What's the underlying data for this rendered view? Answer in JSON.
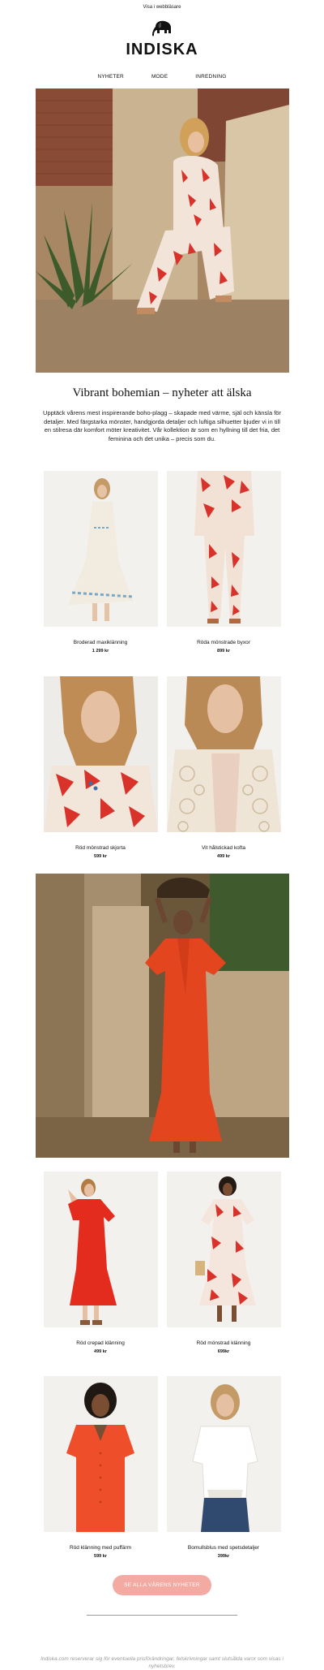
{
  "header": {
    "view_in_browser": "Visa i webbläsare",
    "brand": "INDISKA",
    "logo_icon": "elephant-icon",
    "nav": [
      "NYHETER",
      "MODE",
      "INREDNING"
    ]
  },
  "intro": {
    "headline": "Vibrant bohemian – nyheter att älska",
    "body": "Upptäck vårens mest inspirerande boho-plagg – skapade med värme, själ och känsla för detaljer. Med färgstarka mönster, handgjorda detaljer och luftiga silhuetter bjuder vi in till en stilresa där komfort möter kreativitet. Vår kollektion är som en hyllning till det fria, det feminina och det unika – precis som du."
  },
  "products": [
    {
      "name": "Broderad maxiklänning",
      "price": "1 299 kr"
    },
    {
      "name": "Röda mönstrade byxor",
      "price": "899 kr"
    },
    {
      "name": "Röd mönstrad skjorta",
      "price": "599 kr"
    },
    {
      "name": "Vit hålstickad kofta",
      "price": "499 kr"
    },
    {
      "name": "Röd crepad klänning",
      "price": "499 kr"
    },
    {
      "name": "Röd mönstrad klänning",
      "price": "699kr"
    },
    {
      "name": "Röd klänning med puffärm",
      "price": "599 kr"
    },
    {
      "name": "Bomullsblus med spetsdetaljer",
      "price": "399kr"
    }
  ],
  "cta": {
    "label": "SE ALLA VÅRENS NYHETER"
  },
  "footer": {
    "disclaimer": "Indiska.com reserverar sig för eventuella prisförändringar, felskrivningar samt slutsålda varor som visas i nyhetsbrev."
  },
  "colors": {
    "accent_red": "#d8322a",
    "cta_pink": "#f2aaa3",
    "text": "#111111"
  }
}
